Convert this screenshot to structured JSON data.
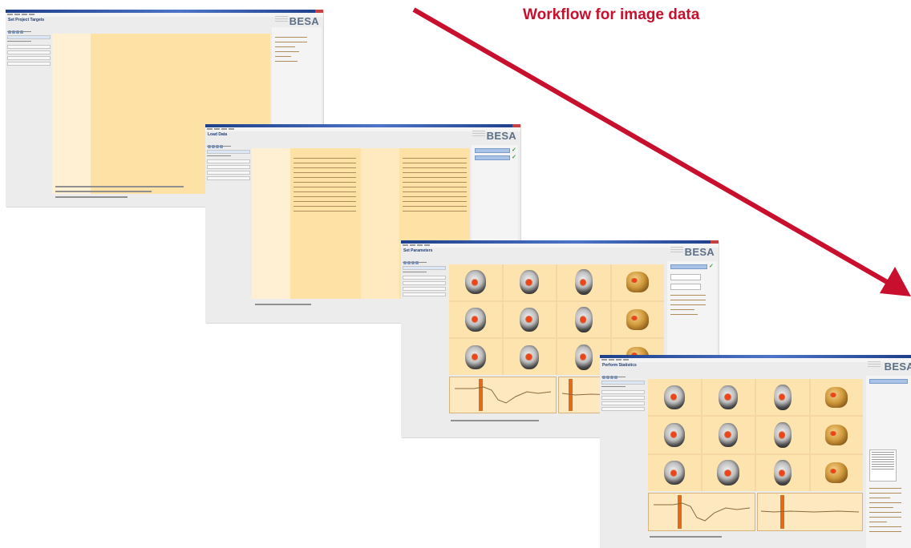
{
  "headline": "Workflow for image data",
  "colors": {
    "accent": "#c8102e",
    "content_orange": "#fee2a5",
    "window_gray": "#ececec"
  },
  "windows": [
    {
      "title": "Set Project Targets",
      "logo": "BESA"
    },
    {
      "title": "Load Data",
      "logo": "BESA"
    },
    {
      "title": "Set Parameters",
      "logo": "BESA"
    },
    {
      "title": "Perform Statistics",
      "logo": "BESA"
    }
  ],
  "icons": [
    "workflow-arrow-icon",
    "besa-logo",
    "checkmark-icon",
    "brain-slice-icon",
    "brain-3d-icon"
  ]
}
